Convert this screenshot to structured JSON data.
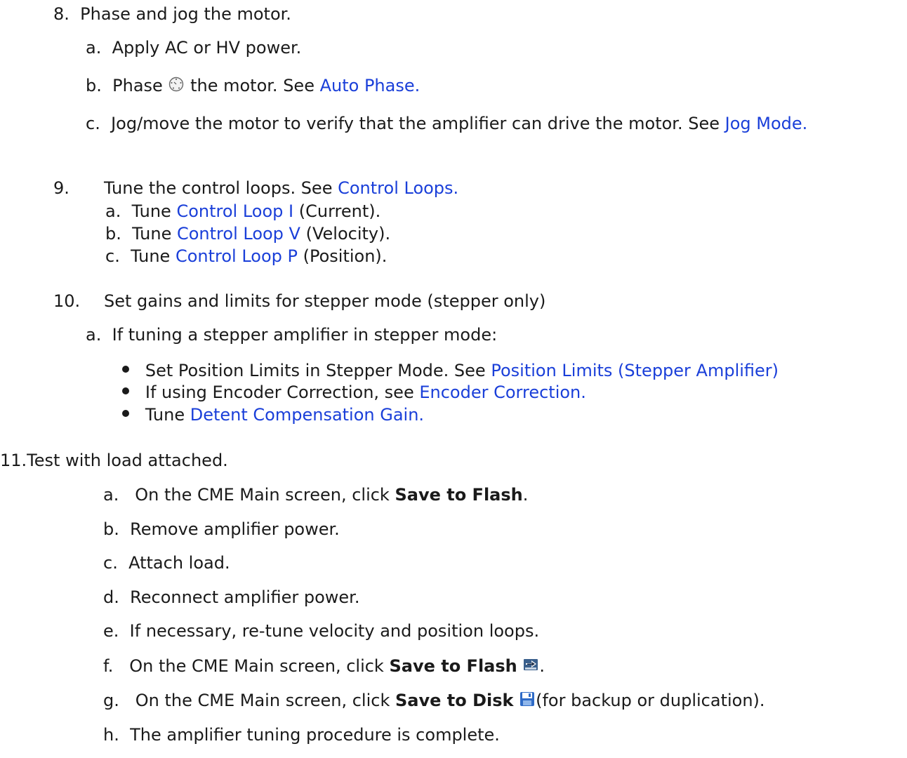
{
  "step8": {
    "num": "8.",
    "title": "Phase and jog the motor.",
    "a": {
      "marker": "a.",
      "text": "Apply AC or HV power."
    },
    "b": {
      "marker": "b.",
      "pre": "Phase",
      "icon": "phase-dial-icon",
      "mid": "the motor.  See",
      "link": "Auto Phase."
    },
    "c": {
      "marker": "c.",
      "pre": "Jog/move the motor to verify that the amplifier can drive the motor.  See",
      "link": "Jog Mode."
    }
  },
  "step9": {
    "num": "9.",
    "pre": "Tune the control loops. See",
    "link": "Control Loops.",
    "items": [
      {
        "marker": "a.",
        "pre": "Tune",
        "link": "Control Loop I",
        "post": "(Current)."
      },
      {
        "marker": "b.",
        "pre": "Tune",
        "link": "Control Loop V",
        "post": "(Velocity)."
      },
      {
        "marker": "c.",
        "pre": "Tune",
        "link": "Control Loop P",
        "post": "(Position)."
      }
    ]
  },
  "step10": {
    "num": "10.",
    "title": "Set gains and limits for stepper mode (stepper only)",
    "a": {
      "marker": "a.",
      "text": "If tuning a stepper amplifier in stepper mode:"
    },
    "bullets": [
      {
        "pre": "Set Position Limits in Stepper Mode.  See",
        "link": "Position Limits (Stepper Amplifier)"
      },
      {
        "pre": "If using Encoder Correction, see",
        "link": "Encoder Correction."
      },
      {
        "pre": "Tune",
        "link": "Detent Compensation Gain."
      }
    ]
  },
  "step11": {
    "num": "11.",
    "title": "Test with load attached.",
    "items": {
      "a": {
        "marker": "a.",
        "pre": "On the CME Main screen, click",
        "bold": "Save to Flash",
        "post": "."
      },
      "b": {
        "marker": "b.",
        "text": "Remove amplifier power."
      },
      "c": {
        "marker": "c.",
        "text": "Attach load."
      },
      "d": {
        "marker": "d.",
        "text": "Reconnect amplifier power."
      },
      "e": {
        "marker": "e.",
        "text": "If necessary, re-tune velocity and position loops."
      },
      "f": {
        "marker": "f.",
        "pre": "On the CME Main screen, click",
        "bold": "Save to Flash",
        "icon": "save-to-flash-icon",
        "post": "."
      },
      "g": {
        "marker": "g.",
        "pre": "On the CME Main screen, click",
        "bold": "Save to Disk",
        "icon": "save-to-disk-icon",
        "post": "(for backup or duplication)."
      },
      "h": {
        "marker": "h.",
        "text": "The amplifier tuning procedure is complete."
      }
    }
  }
}
